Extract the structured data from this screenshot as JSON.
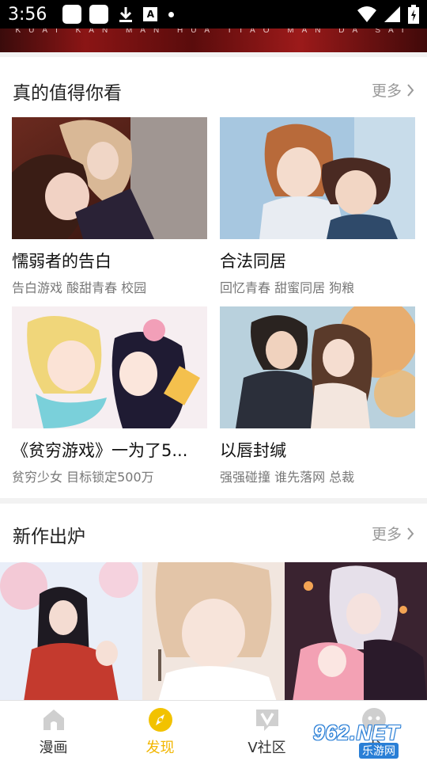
{
  "status_bar": {
    "time": "3:56"
  },
  "banner": {
    "text": "KUAI KAN MAN HUA TIAO MAN DA SAI"
  },
  "recommend": {
    "title": "真的值得你看",
    "more": "更多",
    "items": [
      {
        "title": "懦弱者的告白",
        "tags": "告白游戏 酸甜青春 校园"
      },
      {
        "title": "合法同居",
        "tags": "回忆青春 甜蜜同居 狗粮"
      },
      {
        "title": "《贫穷游戏》一为了5...",
        "tags": "贫穷少女 目标锁定500万"
      },
      {
        "title": "以唇封缄",
        "tags": "强强碰撞 谁先落网 总裁"
      }
    ]
  },
  "new_works": {
    "title": "新作出炉",
    "more": "更多"
  },
  "bottom_nav": {
    "items": [
      {
        "label": "漫画",
        "icon": "house-icon"
      },
      {
        "label": "发现",
        "icon": "compass-icon"
      },
      {
        "label": "V社区",
        "icon": "v-chat-icon"
      },
      {
        "label": "书",
        "icon": "face-icon"
      }
    ],
    "active_index": 1
  },
  "watermark": {
    "brand": "962.NET",
    "sub": "乐游网"
  },
  "colors": {
    "accent": "#f2b600",
    "more_gray": "#999999"
  }
}
